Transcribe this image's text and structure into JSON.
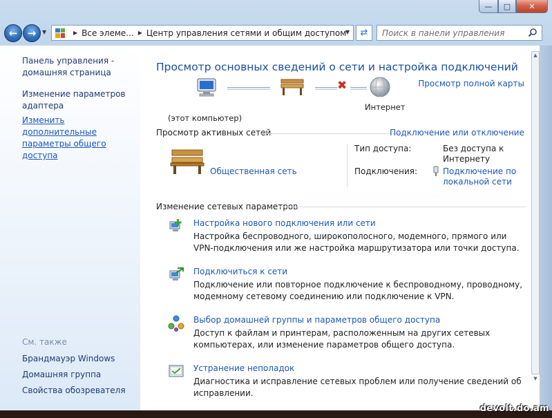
{
  "window": {
    "minimize_glyph": "—",
    "maximize_glyph": "□",
    "close_glyph": "✕"
  },
  "nav": {
    "breadcrumb_root": "Все элеме...",
    "breadcrumb_current": "Центр управления сетями и общим доступом",
    "search_placeholder": "Поиск в панели управления"
  },
  "sidebar": {
    "home_link": "Панель управления - домашняя страница",
    "items": [
      {
        "label": "Изменение параметров адаптера"
      },
      {
        "label": "Изменить дополнительные параметры общего доступа"
      }
    ],
    "see_also_header": "См. также",
    "see_also": [
      {
        "label": "Брандмауэр Windows"
      },
      {
        "label": "Домашняя группа"
      },
      {
        "label": "Свойства обозревателя"
      }
    ]
  },
  "main": {
    "title": "Просмотр основных сведений о сети и настройка подключений",
    "map_link": "Просмотр полной карты",
    "map_nodes": {
      "computer": "(этот компьютер)",
      "internet": "Интернет"
    },
    "active_networks": {
      "header": "Просмотр активных сетей",
      "connect_link": "Подключение или отключение",
      "network_name": "Общественная сеть",
      "access_type_label": "Тип доступа:",
      "access_type_value": "Без доступа к Интернету",
      "connections_label": "Подключения:",
      "connections_value": "Подключение по локальной сети"
    },
    "change_settings": {
      "header": "Изменение сетевых параметров",
      "tasks": [
        {
          "title": "Настройка нового подключения или сети",
          "description": "Настройка беспроводного, широкополосного, модемного, прямого или VPN-подключения или же настройка маршрутизатора или точки доступа.",
          "icon": "new-connection-icon"
        },
        {
          "title": "Подключиться к сети",
          "description": "Подключение или повторное подключение к беспроводному, проводному, модемному сетевому соединению или подключение к VPN.",
          "icon": "connect-network-icon"
        },
        {
          "title": "Выбор домашней группы и параметров общего доступа",
          "description": "Доступ к файлам и принтерам, расположенным на других сетевых компьютерах, или изменение параметров общего доступа.",
          "icon": "homegroup-icon"
        },
        {
          "title": "Устранение неполадок",
          "description": "Диагностика и исправление сетевых проблем или получение сведений об исправлении.",
          "icon": "troubleshoot-icon"
        }
      ]
    }
  },
  "watermark": "devolt.do.am",
  "colors": {
    "link": "#1a56b8",
    "title": "#1a4fa0",
    "error_x": "#d42a1f"
  }
}
